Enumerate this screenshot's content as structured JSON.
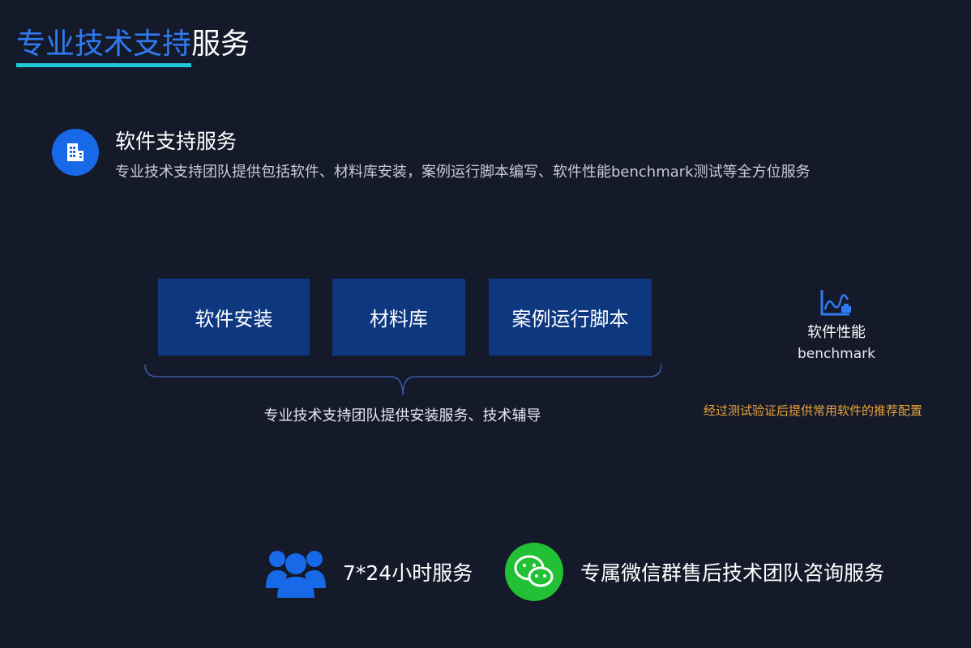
{
  "title": {
    "accent": "专业技术支持",
    "rest": "服务"
  },
  "section": {
    "icon": "building-icon",
    "title": "软件支持服务",
    "description": "专业技术支持团队提供包括软件、材料库安装，案例运行脚本编写、软件性能benchmark测试等全方位服务"
  },
  "boxes": [
    {
      "label": "软件安装"
    },
    {
      "label": "材料库"
    },
    {
      "label": "案例运行脚本"
    }
  ],
  "brace_caption": "专业技术支持团队提供安装服务、技术辅导",
  "benchmark": {
    "icon": "chart-icon",
    "title": "软件性能",
    "subtitle": "benchmark",
    "note": "经过测试验证后提供常用软件的推荐配置"
  },
  "bottom": {
    "hours": {
      "icon": "users-icon",
      "label": "7*24小时服务"
    },
    "wechat": {
      "icon": "wechat-icon",
      "label": "专属微信群售后技术团队咨询服务"
    }
  },
  "colors": {
    "background": "#151a2a",
    "title_accent": "#2f7bf2",
    "underline": "#1ec8d6",
    "box": "#0d3880",
    "note": "#e8a23a",
    "wechat": "#22c035",
    "icon_blue": "#1769e8"
  }
}
